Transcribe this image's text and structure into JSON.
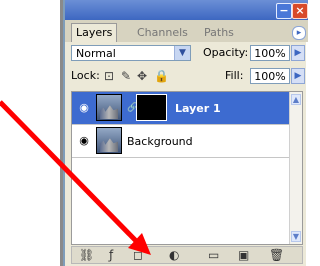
{
  "panel": {
    "title_buttons": {
      "minimize": "−",
      "close": "×"
    },
    "tabs": [
      {
        "label": "Layers",
        "active": true
      },
      {
        "label": "Channels",
        "active": false
      },
      {
        "label": "Paths",
        "active": false
      }
    ],
    "tab_menu_icon": "menu-arrow-icon"
  },
  "blend": {
    "mode": "Normal",
    "opacity_label": "Opacity:",
    "opacity_value": "100%",
    "lock_label": "Lock:",
    "fill_label": "Fill:",
    "fill_value": "100%"
  },
  "layers": [
    {
      "name": "Layer 1",
      "selected": true,
      "visible": true,
      "has_mask": true
    },
    {
      "name": "Background",
      "selected": false,
      "visible": true,
      "has_mask": false
    }
  ],
  "footer_icons": [
    "link-layers-icon",
    "layer-style-icon",
    "add-mask-icon",
    "adjustment-layer-icon",
    "new-group-icon",
    "new-layer-icon",
    "delete-layer-icon"
  ],
  "annotation": {
    "arrow_color": "#ff0000"
  }
}
